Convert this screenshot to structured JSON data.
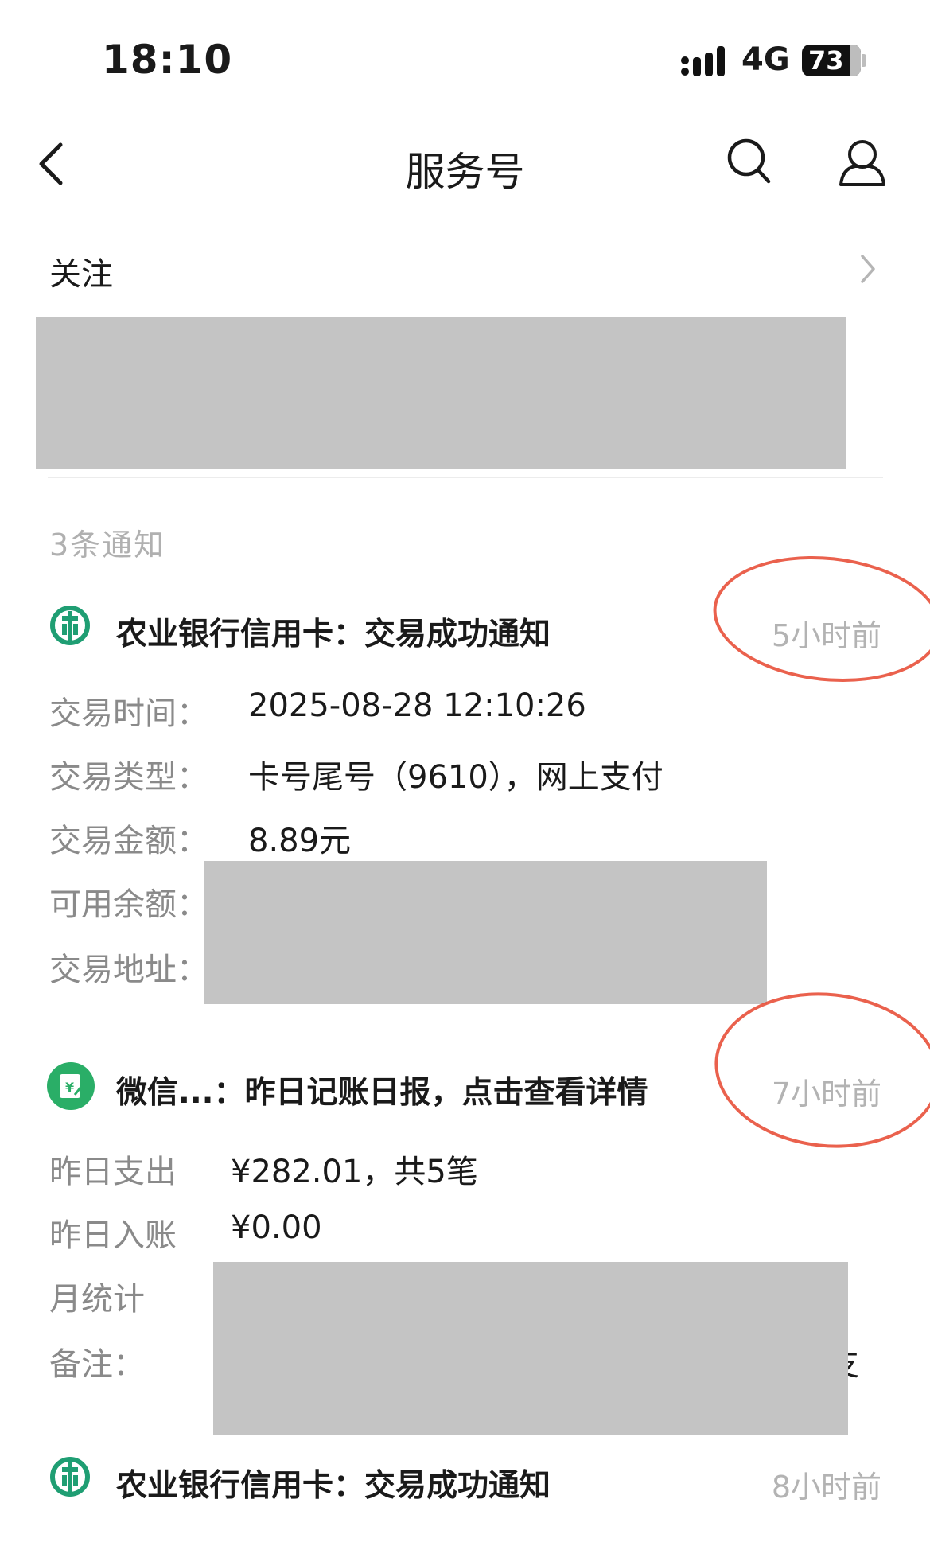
{
  "status_bar": {
    "time": "18:10",
    "network": "4G",
    "battery": "73"
  },
  "nav": {
    "title": "服务号"
  },
  "follow": {
    "label": "关注"
  },
  "notifications": {
    "count_label": "3条通知",
    "items": [
      {
        "title": "农业银行信用卡：交易成功通知",
        "time_ago": "5小时前",
        "rows": [
          {
            "label": "交易时间：",
            "value": "2025-08-28 12:10:26"
          },
          {
            "label": "交易类型：",
            "value": "卡号尾号（9610），网上支付"
          },
          {
            "label": "交易金额：",
            "value": "8.89元"
          },
          {
            "label": "可用余额：",
            "value": ""
          },
          {
            "label": "交易地址：",
            "value": ""
          }
        ]
      },
      {
        "title": "微信...：昨日记账日报，点击查看详情",
        "time_ago": "7小时前",
        "rows": [
          {
            "label": "昨日支出",
            "value": "¥282.01，共5笔"
          },
          {
            "label": "昨日入账",
            "value": "¥0.00"
          },
          {
            "label": "月统计",
            "value": ""
          },
          {
            "label": "备注：",
            "value": ""
          }
        ],
        "trailing_glyph": "支"
      },
      {
        "title": "农业银行信用卡：交易成功通知",
        "time_ago": "8小时前"
      }
    ]
  },
  "colors": {
    "bank_green": "#1f9e73",
    "wechat_green": "#2aae67",
    "redaction": "#c4c4c4",
    "annotation_red": "#e8503a"
  },
  "icons": [
    "signal-icon",
    "battery-icon",
    "back-icon",
    "search-icon",
    "profile-icon",
    "chevron-right-icon",
    "abc-bank-icon",
    "wechat-ledger-icon"
  ]
}
